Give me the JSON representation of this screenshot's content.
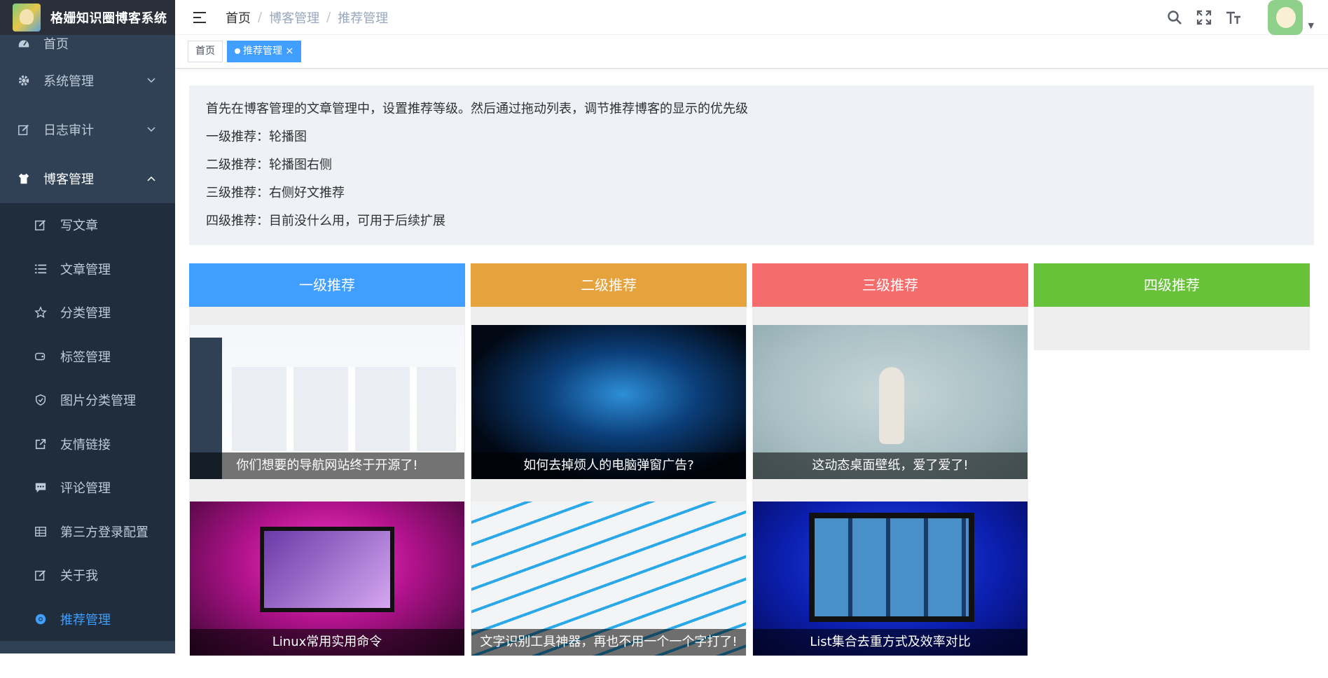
{
  "app": {
    "title": "格姗知识圈博客系统"
  },
  "sidebar": {
    "items": [
      {
        "label": "首页",
        "icon": "dashboard-icon"
      },
      {
        "label": "系统管理",
        "icon": "gear-icon"
      },
      {
        "label": "日志审计",
        "icon": "edit-icon"
      },
      {
        "label": "博客管理",
        "icon": "shirt-icon"
      }
    ],
    "sub_items": [
      {
        "label": "写文章",
        "icon": "edit-icon"
      },
      {
        "label": "文章管理",
        "icon": "list-icon"
      },
      {
        "label": "分类管理",
        "icon": "star-icon"
      },
      {
        "label": "标签管理",
        "icon": "tag-icon"
      },
      {
        "label": "图片分类管理",
        "icon": "shield-icon"
      },
      {
        "label": "友情链接",
        "icon": "external-link-icon"
      },
      {
        "label": "评论管理",
        "icon": "comment-icon"
      },
      {
        "label": "第三方登录配置",
        "icon": "table-icon"
      },
      {
        "label": "关于我",
        "icon": "edit-icon"
      },
      {
        "label": "推荐管理",
        "icon": "chrome-icon"
      }
    ]
  },
  "navbar": {
    "breadcrumb": [
      "首页",
      "博客管理",
      "推荐管理"
    ],
    "separator": "/"
  },
  "tags": {
    "home": "首页",
    "active": "推荐管理",
    "close": "×"
  },
  "tips": {
    "line1": "首先在博客管理的文章管理中，设置推荐等级。然后通过拖动列表，调节推荐博客的显示的优先级",
    "line2": "一级推荐：轮播图",
    "line3": "二级推荐：轮播图右侧",
    "line4": "三级推荐：右侧好文推荐",
    "line5": "四级推荐：目前没什么用，可用于后续扩展"
  },
  "columns": [
    {
      "title": "一级推荐",
      "color": "#409eff",
      "cards": [
        "你们想要的导航网站终于开源了!",
        "Linux常用实用命令"
      ]
    },
    {
      "title": "二级推荐",
      "color": "#e6a23c",
      "cards": [
        "如何去掉烦人的电脑弹窗广告?",
        "文字识别工具神器，再也不用一个一个字打了!"
      ]
    },
    {
      "title": "三级推荐",
      "color": "#f56c6c",
      "cards": [
        "这动态桌面壁纸，爱了爱了!",
        "List集合去重方式及效率对比"
      ]
    },
    {
      "title": "四级推荐",
      "color": "#67c23a",
      "cards": []
    }
  ]
}
